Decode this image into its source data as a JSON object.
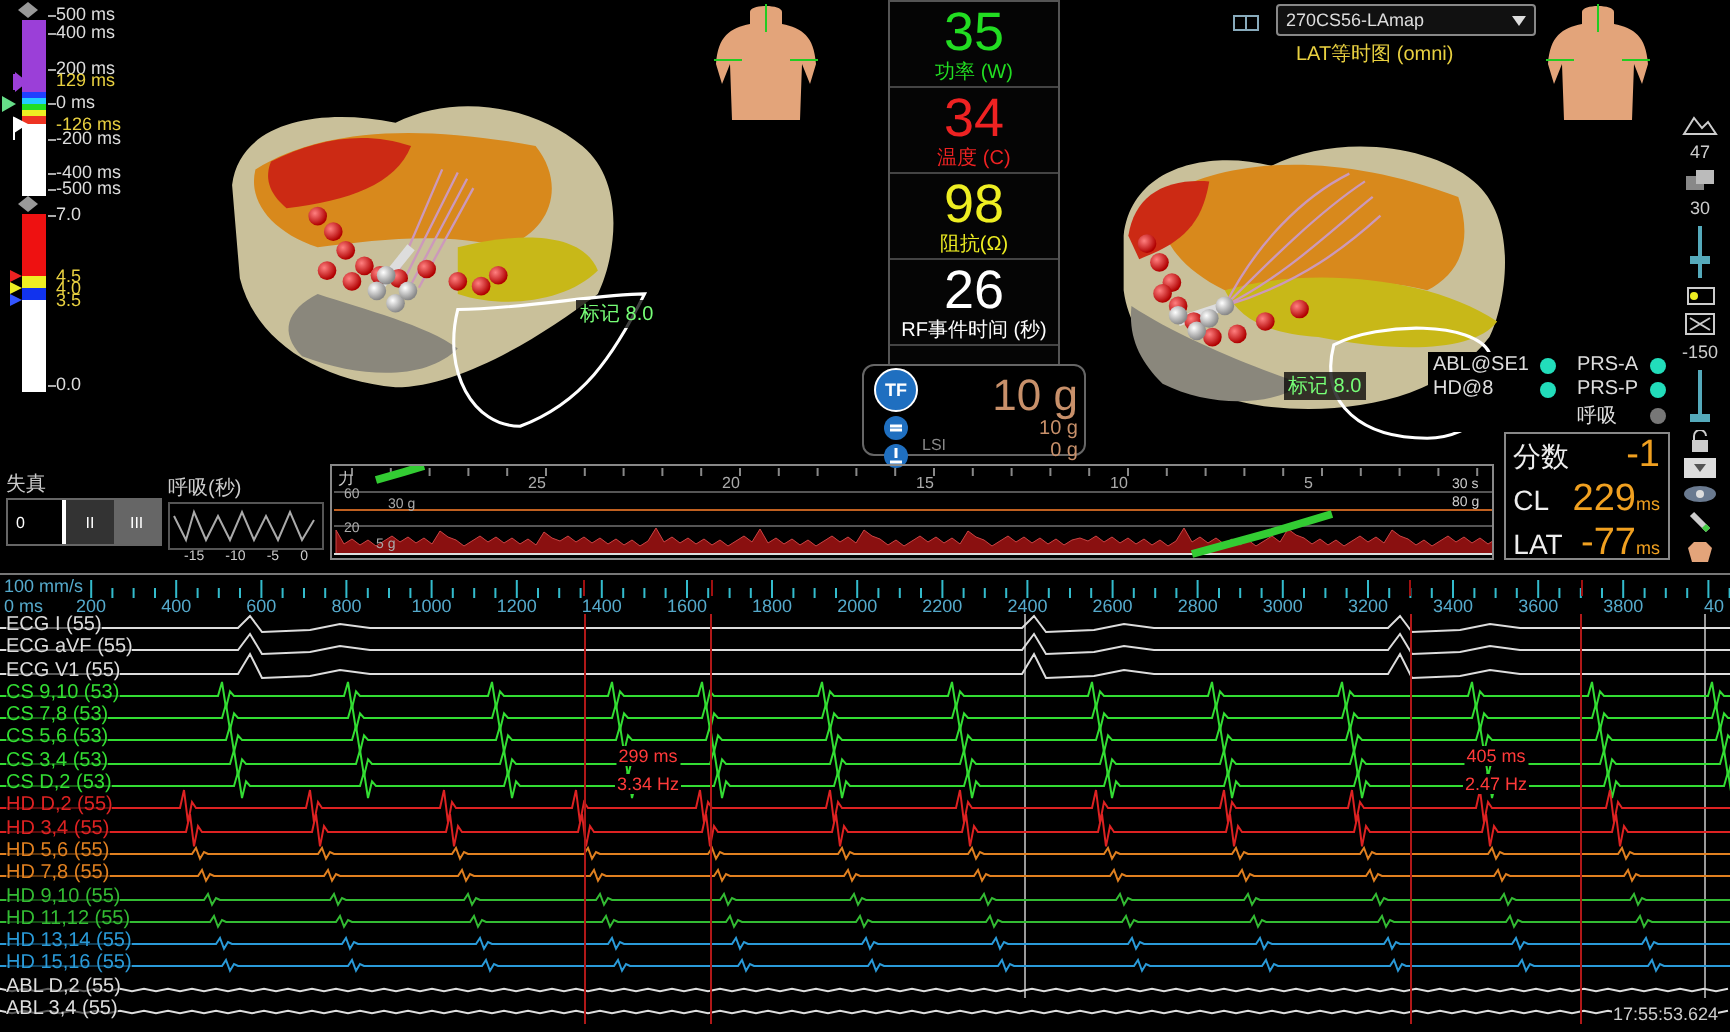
{
  "lat_scale": [
    {
      "text": "500 ms",
      "kind": "tick"
    },
    {
      "text": "400 ms",
      "kind": "tick"
    },
    {
      "text": "200 ms",
      "kind": "tick"
    },
    {
      "text": "129 ms",
      "kind": "marker"
    },
    {
      "text": "0 ms",
      "kind": "tick"
    },
    {
      "text": "-126 ms",
      "kind": "marker"
    },
    {
      "text": "-200 ms",
      "kind": "tick"
    },
    {
      "text": "-400 ms",
      "kind": "tick"
    },
    {
      "text": "-500 ms",
      "kind": "tick"
    }
  ],
  "voltage_scale": [
    {
      "text": "7.0",
      "kind": "tick"
    },
    {
      "text": "4.5",
      "kind": "marker"
    },
    {
      "text": "4.0",
      "kind": "marker"
    },
    {
      "text": "3.5",
      "kind": "marker"
    },
    {
      "text": "0.0",
      "kind": "tick"
    }
  ],
  "left_view": {
    "marker_label": "标记 8.0"
  },
  "vitals": [
    {
      "value": "35",
      "label": "功率 (W)",
      "color": "#22dd22"
    },
    {
      "value": "34",
      "label": "温度 (C)",
      "color": "#ee2222"
    },
    {
      "value": "98",
      "label": "阻抗(Ω)",
      "color": "#eeee22"
    },
    {
      "value": "26",
      "label": "RF事件时间 (秒)",
      "color": "#ffffff"
    }
  ],
  "force": {
    "badge": "TF",
    "value": "10 g",
    "label": "LSI",
    "readings": [
      "10 g",
      "0 g"
    ]
  },
  "right_view": {
    "map_select": "270CS56-LAmap",
    "map_type": "LAT等时图 (omni)",
    "marker_label": "标记 8.0",
    "status": [
      {
        "name": "ABL@SE1",
        "color": "#22ddbb"
      },
      {
        "name": "PRS-A",
        "color": "#22ddbb"
      },
      {
        "name": "HD@8",
        "color": "#22ddbb"
      },
      {
        "name": "PRS-P",
        "color": "#22ddbb"
      },
      {
        "name": "呼吸",
        "color": "#777777"
      }
    ]
  },
  "toolbar": {
    "values": [
      "47",
      "30",
      "-150"
    ]
  },
  "distortion": {
    "title": "失真",
    "segments": [
      "0",
      "II",
      "III"
    ]
  },
  "respiration": {
    "title": "呼吸(秒)",
    "ticks": [
      "-15",
      "-10",
      "-5",
      "0"
    ]
  },
  "force_chart": {
    "title": "力",
    "yticks": [
      "60",
      "20"
    ],
    "xticks": [
      "25",
      "20",
      "15",
      "10",
      "5"
    ],
    "end_label": "30 s",
    "max_label": "80 g",
    "target_label": "30 g",
    "min_label": "5 g"
  },
  "score_panel": [
    {
      "label": "分数",
      "value": "-1"
    },
    {
      "label": "CL",
      "value": "229",
      "unit": "ms"
    },
    {
      "label": "LAT",
      "value": "-77",
      "unit": "ms"
    }
  ],
  "ruler": {
    "speed": "100 mm/s",
    "start": "0 ms",
    "labels": [
      "200",
      "400",
      "600",
      "800",
      "1000",
      "1200",
      "1400",
      "1600",
      "1800",
      "2000",
      "2200",
      "2400",
      "2600",
      "2800",
      "3000",
      "3200",
      "3400",
      "3600",
      "3800",
      "40"
    ]
  },
  "traces": [
    {
      "label": "ECG I (55)",
      "color": "#dddddd",
      "kind": "ecg"
    },
    {
      "label": "ECG aVF (55)",
      "color": "#dddddd",
      "kind": "ecg"
    },
    {
      "label": "ECG V1 (55)",
      "color": "#dddddd",
      "kind": "ecg"
    },
    {
      "label": "CS 9,10 (53)",
      "color": "#33dd33",
      "kind": "cs"
    },
    {
      "label": "CS 7,8 (53)",
      "color": "#33dd33",
      "kind": "cs"
    },
    {
      "label": "CS 5,6 (53)",
      "color": "#33dd33",
      "kind": "cs"
    },
    {
      "label": "CS 3,4 (53)",
      "color": "#33dd33",
      "kind": "cs"
    },
    {
      "label": "CS D,2 (53)",
      "color": "#33dd33",
      "kind": "cs"
    },
    {
      "label": "HD D,2 (55)",
      "color": "#dd2222",
      "kind": "hd"
    },
    {
      "label": "HD 3,4 (55)",
      "color": "#dd2222",
      "kind": "hd"
    },
    {
      "label": "HD 5,6 (55)",
      "color": "#e08020",
      "kind": "hd"
    },
    {
      "label": "HD 7,8 (55)",
      "color": "#e08020",
      "kind": "hd"
    },
    {
      "label": "HD 9,10 (55)",
      "color": "#33bb33",
      "kind": "hd"
    },
    {
      "label": "HD 11,12 (55)",
      "color": "#33bb33",
      "kind": "hd"
    },
    {
      "label": "HD 13,14 (55)",
      "color": "#2a9ad8",
      "kind": "hd"
    },
    {
      "label": "HD 15,16 (55)",
      "color": "#2a9ad8",
      "kind": "hd"
    },
    {
      "label": "ABL D,2 (55)",
      "color": "#dddddd",
      "kind": "abl"
    },
    {
      "label": "ABL 3,4 (55)",
      "color": "#dddddd",
      "kind": "abl"
    }
  ],
  "calipers": [
    {
      "interval": "299 ms",
      "rate": "3.34 Hz"
    },
    {
      "interval": "405 ms",
      "rate": "2.47 Hz"
    }
  ],
  "timestamp": "17:55:53.624"
}
